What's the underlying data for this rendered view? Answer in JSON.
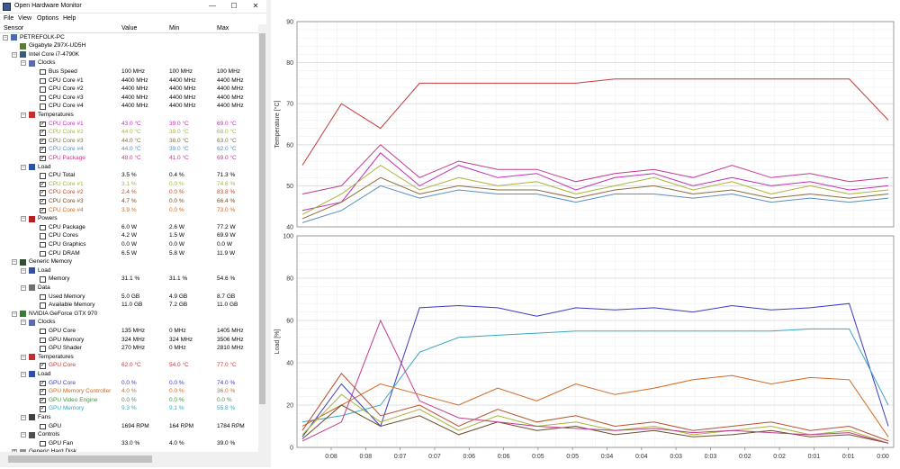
{
  "window": {
    "title": "Open Hardware Monitor",
    "minimize_label": "—",
    "maximize_label": "☐",
    "close_label": "✕"
  },
  "menu": [
    "File",
    "View",
    "Options",
    "Help"
  ],
  "columns": [
    "Sensor",
    "Value",
    "Min",
    "Max"
  ],
  "tree": [
    {
      "level": 0,
      "expander": "−",
      "icon": "computer-icon",
      "label": "PETREFOLK-PC"
    },
    {
      "level": 1,
      "expander": "",
      "icon": "motherboard-icon",
      "label": "Gigabyte Z97X-UD5H"
    },
    {
      "level": 1,
      "expander": "−",
      "icon": "cpu-icon",
      "label": "Intel Core i7-4790K"
    },
    {
      "level": 2,
      "expander": "−",
      "icon": "clock-icon",
      "label": "Clocks"
    },
    {
      "level": 3,
      "check": false,
      "label": "Bus Speed",
      "value": "100 MHz",
      "min": "100 MHz",
      "max": "100 MHz"
    },
    {
      "level": 3,
      "check": false,
      "label": "CPU Core #1",
      "value": "4400 MHz",
      "min": "4400 MHz",
      "max": "4400 MHz"
    },
    {
      "level": 3,
      "check": false,
      "label": "CPU Core #2",
      "value": "4400 MHz",
      "min": "4400 MHz",
      "max": "4400 MHz"
    },
    {
      "level": 3,
      "check": false,
      "label": "CPU Core #3",
      "value": "4400 MHz",
      "min": "4400 MHz",
      "max": "4400 MHz"
    },
    {
      "level": 3,
      "check": false,
      "label": "CPU Core #4",
      "value": "4400 MHz",
      "min": "4400 MHz",
      "max": "4400 MHz"
    },
    {
      "level": 2,
      "expander": "−",
      "icon": "thermometer-icon",
      "label": "Temperatures"
    },
    {
      "level": 3,
      "check": true,
      "color": "#c22fbd",
      "label": "CPU Core #1",
      "value": "43.0 °C",
      "min": "39.0 °C",
      "max": "69.0 °C"
    },
    {
      "level": 3,
      "check": true,
      "color": "#a8b43a",
      "label": "CPU Core #2",
      "value": "44.0 °C",
      "min": "39.0 °C",
      "max": "68.0 °C"
    },
    {
      "level": 3,
      "check": true,
      "color": "#8c6d3c",
      "label": "CPU Core #3",
      "value": "44.0 °C",
      "min": "38.0 °C",
      "max": "63.0 °C"
    },
    {
      "level": 3,
      "check": true,
      "color": "#5a8fc2",
      "label": "CPU Core #4",
      "value": "44.0 °C",
      "min": "39.0 °C",
      "max": "62.0 °C"
    },
    {
      "level": 3,
      "check": true,
      "color": "#c23a8e",
      "label": "CPU Package",
      "value": "48.0 °C",
      "min": "41.0 °C",
      "max": "69.0 °C"
    },
    {
      "level": 2,
      "expander": "−",
      "icon": "load-icon",
      "label": "Load"
    },
    {
      "level": 3,
      "check": false,
      "label": "CPU Total",
      "value": "3.5 %",
      "min": "0.4 %",
      "max": "71.3 %"
    },
    {
      "level": 3,
      "check": true,
      "color": "#a8b43a",
      "label": "CPU Core #1",
      "value": "3.1 %",
      "min": "0.0 %",
      "max": "74.6 %"
    },
    {
      "level": 3,
      "check": true,
      "color": "#b8502e",
      "label": "CPU Core #2",
      "value": "2.4 %",
      "min": "0.0 %",
      "max": "83.8 %"
    },
    {
      "level": 3,
      "check": true,
      "color": "#6b4d2a",
      "label": "CPU Core #3",
      "value": "4.7 %",
      "min": "0.0 %",
      "max": "66.4 %"
    },
    {
      "level": 3,
      "check": true,
      "color": "#d2691e",
      "label": "CPU Core #4",
      "value": "3.9 %",
      "min": "0.0 %",
      "max": "73.0 %"
    },
    {
      "level": 2,
      "expander": "−",
      "icon": "power-icon",
      "label": "Powers"
    },
    {
      "level": 3,
      "check": false,
      "label": "CPU Package",
      "value": "6.0 W",
      "min": "2.6 W",
      "max": "77.2 W"
    },
    {
      "level": 3,
      "check": false,
      "label": "CPU Cores",
      "value": "4.2 W",
      "min": "1.5 W",
      "max": "69.9 W"
    },
    {
      "level": 3,
      "check": false,
      "label": "CPU Graphics",
      "value": "0.0 W",
      "min": "0.0 W",
      "max": "0.0 W"
    },
    {
      "level": 3,
      "check": false,
      "label": "CPU DRAM",
      "value": "6.5 W",
      "min": "5.8 W",
      "max": "11.9 W"
    },
    {
      "level": 1,
      "expander": "−",
      "icon": "memory-icon",
      "label": "Generic Memory"
    },
    {
      "level": 2,
      "expander": "−",
      "icon": "load-icon",
      "label": "Load"
    },
    {
      "level": 3,
      "check": false,
      "label": "Memory",
      "value": "31.1 %",
      "min": "31.1 %",
      "max": "54.6 %"
    },
    {
      "level": 2,
      "expander": "−",
      "icon": "data-icon",
      "label": "Data"
    },
    {
      "level": 3,
      "check": false,
      "label": "Used Memory",
      "value": "5.0 GB",
      "min": "4.9 GB",
      "max": "8.7 GB"
    },
    {
      "level": 3,
      "check": false,
      "label": "Available Memory",
      "value": "11.0 GB",
      "min": "7.2 GB",
      "max": "11.0 GB"
    },
    {
      "level": 1,
      "expander": "−",
      "icon": "gpu-icon",
      "label": "NVIDIA GeForce GTX 970"
    },
    {
      "level": 2,
      "expander": "−",
      "icon": "clock-icon",
      "label": "Clocks"
    },
    {
      "level": 3,
      "check": false,
      "label": "GPU Core",
      "value": "135 MHz",
      "min": "0 MHz",
      "max": "1405 MHz"
    },
    {
      "level": 3,
      "check": false,
      "label": "GPU Memory",
      "value": "324 MHz",
      "min": "324 MHz",
      "max": "3506 MHz"
    },
    {
      "level": 3,
      "check": false,
      "label": "GPU Shader",
      "value": "270 MHz",
      "min": "0 MHz",
      "max": "2810 MHz"
    },
    {
      "level": 2,
      "expander": "−",
      "icon": "thermometer-icon",
      "label": "Temperatures"
    },
    {
      "level": 3,
      "check": true,
      "color": "#c23a3a",
      "label": "GPU Core",
      "value": "62.0 °C",
      "min": "54.0 °C",
      "max": "77.0 °C"
    },
    {
      "level": 2,
      "expander": "−",
      "icon": "load-icon",
      "label": "Load"
    },
    {
      "level": 3,
      "check": true,
      "color": "#3a3ac2",
      "label": "GPU Core",
      "value": "0.0 %",
      "min": "0.0 %",
      "max": "74.0 %"
    },
    {
      "level": 3,
      "check": true,
      "color": "#d2691e",
      "label": "GPU Memory Controller",
      "value": "4.0 %",
      "min": "0.0 %",
      "max": "36.0 %"
    },
    {
      "level": 3,
      "check": true,
      "color": "#3a9a3a",
      "label": "GPU Video Engine",
      "value": "0.0 %",
      "min": "0.0 %",
      "max": "0.0 %"
    },
    {
      "level": 3,
      "check": true,
      "color": "#3aa6c2",
      "label": "GPU Memory",
      "value": "9.3 %",
      "min": "9.1 %",
      "max": "55.8 %"
    },
    {
      "level": 2,
      "expander": "−",
      "icon": "fan-icon",
      "label": "Fans"
    },
    {
      "level": 3,
      "check": false,
      "label": "GPU",
      "value": "1694 RPM",
      "min": "164 RPM",
      "max": "1784 RPM"
    },
    {
      "level": 2,
      "expander": "−",
      "icon": "control-icon",
      "label": "Controls"
    },
    {
      "level": 3,
      "check": false,
      "label": "GPU Fan",
      "value": "33.0 %",
      "min": "4.0 %",
      "max": "39.0 %"
    },
    {
      "level": 1,
      "expander": "+",
      "icon": "disk-icon",
      "label": "Generic Hard Disk"
    }
  ],
  "plot": {
    "x_ticks": [
      "0:08",
      "0:08",
      "0:07",
      "0:07",
      "0:06",
      "0:06",
      "0:05",
      "0:05",
      "0:04",
      "0:04",
      "0:03",
      "0:03",
      "0:02",
      "0:02",
      "0:01",
      "0:01",
      "0:00"
    ],
    "temperature": {
      "ylabel": "Temperature [°C]",
      "ylim": [
        40,
        90
      ],
      "y_ticks": [
        40,
        50,
        60,
        70,
        80,
        90
      ]
    },
    "load": {
      "ylabel": "Load [%]",
      "ylim": [
        0,
        100
      ],
      "y_ticks": [
        0,
        20,
        40,
        60,
        80,
        100
      ]
    }
  },
  "chart_data": [
    {
      "type": "line",
      "title": "",
      "xlabel": "",
      "ylabel": "Temperature [°C]",
      "ylim": [
        40,
        90
      ],
      "x": [
        "0:08",
        "0:07",
        "0:07",
        "0:06",
        "0:06",
        "0:05",
        "0:05",
        "0:04",
        "0:04",
        "0:03",
        "0:03",
        "0:02",
        "0:02",
        "0:01",
        "0:01",
        "0:00"
      ],
      "series": [
        {
          "color": "#c23a3a",
          "values": [
            55,
            70,
            64,
            75,
            75,
            75,
            75,
            75,
            76,
            76,
            76,
            76,
            76,
            76,
            76,
            66
          ]
        },
        {
          "color": "#c23a8e",
          "values": [
            48,
            50,
            60,
            52,
            56,
            54,
            54,
            51,
            53,
            54,
            52,
            55,
            52,
            53,
            51,
            52
          ]
        },
        {
          "color": "#c22fbd",
          "values": [
            44,
            46,
            58,
            50,
            55,
            52,
            53,
            49,
            52,
            53,
            50,
            52,
            50,
            51,
            49,
            50
          ]
        },
        {
          "color": "#a8b43a",
          "values": [
            43,
            48,
            55,
            49,
            52,
            50,
            51,
            48,
            50,
            52,
            49,
            51,
            48,
            50,
            48,
            49
          ]
        },
        {
          "color": "#8c6d3c",
          "values": [
            42,
            46,
            52,
            48,
            50,
            49,
            49,
            47,
            49,
            50,
            48,
            49,
            47,
            48,
            47,
            48
          ]
        },
        {
          "color": "#5a8fc2",
          "values": [
            41,
            44,
            50,
            47,
            49,
            48,
            48,
            46,
            48,
            48,
            47,
            48,
            46,
            47,
            46,
            47
          ]
        }
      ]
    },
    {
      "type": "line",
      "title": "",
      "xlabel": "",
      "ylabel": "Load [%]",
      "ylim": [
        0,
        100
      ],
      "x": [
        "0:08",
        "0:07",
        "0:07",
        "0:06",
        "0:06",
        "0:05",
        "0:05",
        "0:04",
        "0:04",
        "0:03",
        "0:03",
        "0:02",
        "0:02",
        "0:01",
        "0:01",
        "0:00"
      ],
      "series": [
        {
          "color": "#3a3ac2",
          "values": [
            5,
            30,
            10,
            66,
            67,
            66,
            62,
            66,
            65,
            66,
            64,
            67,
            65,
            66,
            68,
            10
          ]
        },
        {
          "color": "#3aa6c2",
          "values": [
            12,
            15,
            20,
            45,
            52,
            53,
            54,
            55,
            55,
            55,
            55,
            55,
            55,
            56,
            56,
            20
          ]
        },
        {
          "color": "#d2691e",
          "values": [
            10,
            20,
            30,
            25,
            20,
            28,
            22,
            30,
            25,
            28,
            32,
            34,
            30,
            33,
            32,
            5
          ]
        },
        {
          "color": "#b8502e",
          "values": [
            8,
            35,
            15,
            20,
            10,
            18,
            12,
            15,
            10,
            12,
            8,
            10,
            12,
            8,
            10,
            3
          ]
        },
        {
          "color": "#a8b43a",
          "values": [
            6,
            25,
            12,
            18,
            8,
            15,
            10,
            12,
            8,
            10,
            6,
            8,
            10,
            6,
            8,
            2
          ]
        },
        {
          "color": "#6b4d2a",
          "values": [
            4,
            20,
            10,
            15,
            6,
            12,
            8,
            10,
            6,
            8,
            5,
            6,
            8,
            5,
            6,
            2
          ]
        },
        {
          "color": "#c23a8e",
          "values": [
            3,
            12,
            60,
            22,
            14,
            12,
            10,
            9,
            8,
            9,
            7,
            8,
            7,
            6,
            7,
            2
          ]
        }
      ]
    }
  ]
}
